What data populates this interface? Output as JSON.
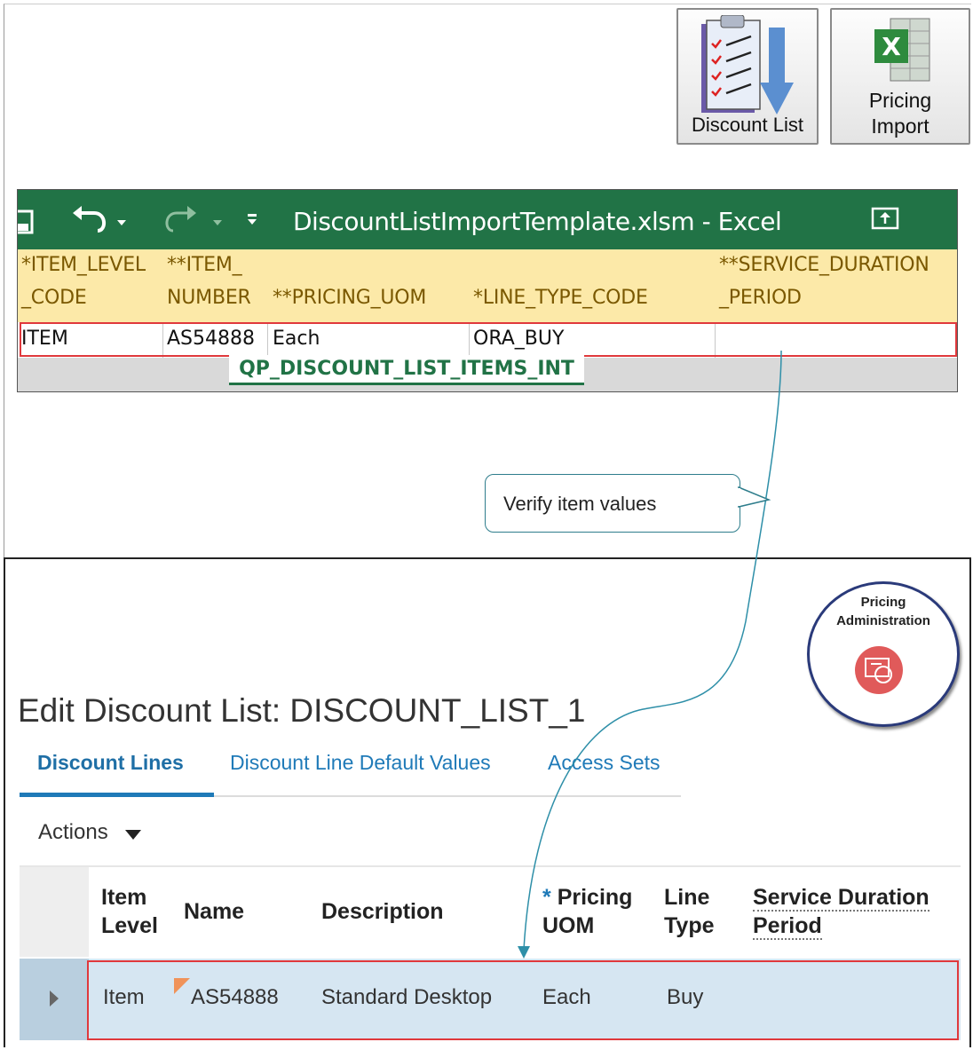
{
  "launchers": {
    "discount_list_label": "Discount List",
    "pricing_import_line1": "Pricing",
    "pricing_import_line2": "Import"
  },
  "excel": {
    "title": "DiscountListImportTemplate.xlsm  -  Excel",
    "header_row1": [
      "*ITEM_LEVEL",
      "**ITEM_",
      "",
      "",
      "**SERVICE_DURATION"
    ],
    "header_row2": [
      "_CODE",
      "NUMBER",
      "**PRICING_UOM",
      "*LINE_TYPE_CODE",
      "_PERIOD"
    ],
    "data_row": [
      "ITEM",
      "AS54888",
      "Each",
      "ORA_BUY",
      ""
    ],
    "sheet_tab": "QP_DISCOUNT_LIST_ITEMS_INT"
  },
  "callout": {
    "text": "Verify  item values"
  },
  "badge": {
    "line1": "Pricing",
    "line2": "Administration"
  },
  "page": {
    "title": "Edit Discount List: DISCOUNT_LIST_1",
    "tabs": [
      "Discount Lines",
      "Discount Line Default Values",
      "Access Sets"
    ],
    "actions_label": "Actions"
  },
  "table": {
    "headers": {
      "item_level_1": "Item",
      "item_level_2": "Level",
      "name": "Name",
      "description": "Description",
      "pricing_uom_star": "*",
      "pricing_uom_1": "Pricing",
      "pricing_uom_2": "UOM",
      "line_type_1": "Line",
      "line_type_2": "Type",
      "service_1": "Service Duration",
      "service_2": "Period"
    },
    "rows": [
      {
        "item_level": "Item",
        "name": "AS54888",
        "description": "Standard Desktop",
        "pricing_uom": "Each",
        "line_type": "Buy",
        "service_duration_period": ""
      }
    ]
  },
  "colors": {
    "excel_green": "#217346",
    "link_blue": "#1f7ab8",
    "highlight_red": "#e0393c",
    "header_yellow": "#fce9a8"
  }
}
